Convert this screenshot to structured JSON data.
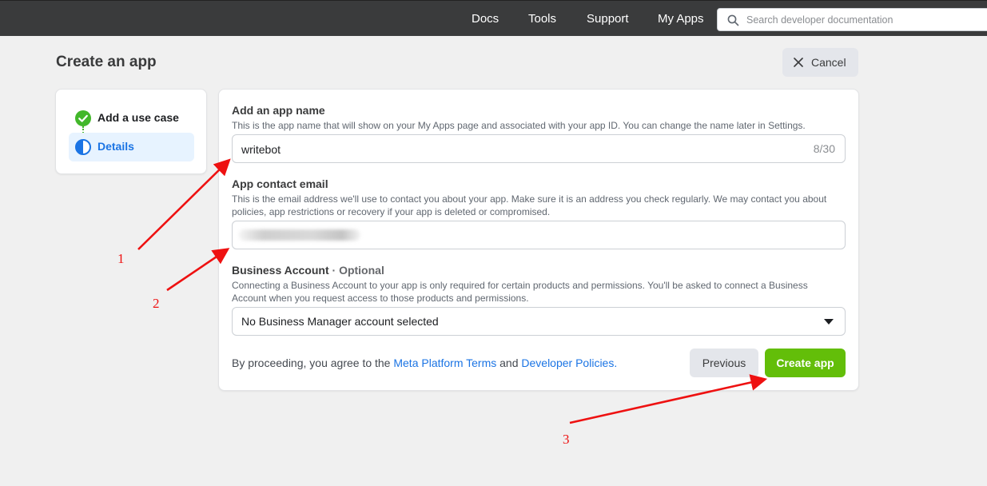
{
  "topbar": {
    "links": [
      "Docs",
      "Tools",
      "Support",
      "My Apps"
    ],
    "search_placeholder": "Search developer documentation"
  },
  "header": {
    "title": "Create an app",
    "cancel_label": "Cancel"
  },
  "steps": [
    {
      "label": "Add a use case",
      "state": "complete",
      "icon": "check-circle-icon"
    },
    {
      "label": "Details",
      "state": "active",
      "icon": "half-circle-icon"
    }
  ],
  "form": {
    "app_name": {
      "label": "Add an app name",
      "help": "This is the app name that will show on your My Apps page and associated with your app ID. You can change the name later in Settings.",
      "value": "writebot",
      "count": "8/30"
    },
    "email": {
      "label": "App contact email",
      "help": "This is the email address we'll use to contact you about your app. Make sure it is an address you check regularly. We may contact you about policies, app restrictions or recovery if your app is deleted or compromised."
    },
    "business": {
      "label": "Business Account",
      "optional": "· Optional",
      "help": "Connecting a Business Account to your app is only required for certain products and permissions. You'll be asked to connect a Business Account when you request access to those products and permissions.",
      "selected": "No Business Manager account selected"
    },
    "terms": {
      "prefix": "By proceeding, you agree to the",
      "link1": "Meta Platform Terms",
      "mid": "and",
      "link2": "Developer Policies."
    },
    "previous_label": "Previous",
    "create_label": "Create app"
  },
  "annotations": [
    "1",
    "2",
    "3"
  ],
  "colors": {
    "topbar": "#3a3b3c",
    "accent_blue": "#1b74e4",
    "create_green": "#63be09",
    "annotation_red": "#e11111"
  }
}
